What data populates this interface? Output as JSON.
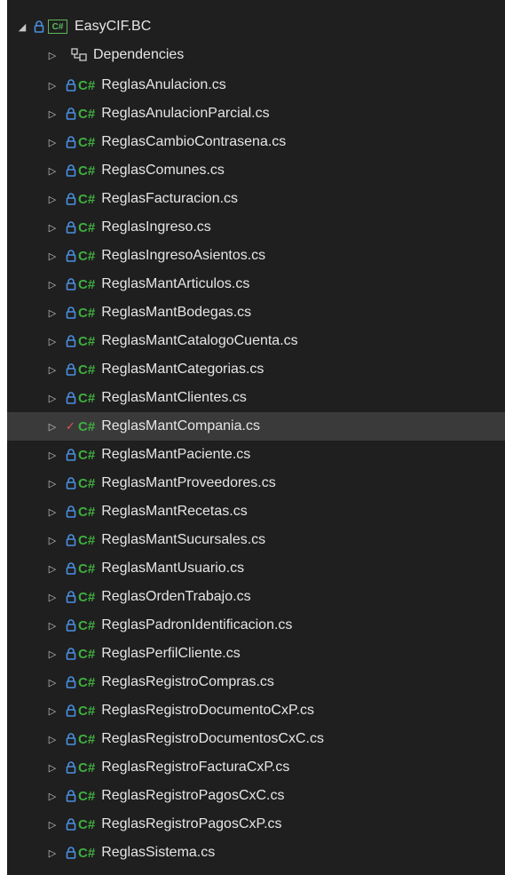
{
  "project": {
    "name": "EasyCIF.BC",
    "icon": "csharp-project-icon",
    "lock_icon": "lock-icon"
  },
  "dependencies": {
    "label": "Dependencies",
    "icon": "dependencies-icon"
  },
  "file_icon": "csharp-file-icon",
  "file_icon_text": "C#",
  "expand_glyph": "▷",
  "collapse_glyph": "◢",
  "files": [
    {
      "name": "ReglasAnulacion.cs",
      "status": "lock"
    },
    {
      "name": "ReglasAnulacionParcial.cs",
      "status": "lock"
    },
    {
      "name": "ReglasCambioContrasena.cs",
      "status": "lock"
    },
    {
      "name": "ReglasComunes.cs",
      "status": "lock"
    },
    {
      "name": "ReglasFacturacion.cs",
      "status": "lock"
    },
    {
      "name": "ReglasIngreso.cs",
      "status": "lock"
    },
    {
      "name": "ReglasIngresoAsientos.cs",
      "status": "lock"
    },
    {
      "name": "ReglasMantArticulos.cs",
      "status": "lock"
    },
    {
      "name": "ReglasMantBodegas.cs",
      "status": "lock"
    },
    {
      "name": "ReglasMantCatalogoCuenta.cs",
      "status": "lock"
    },
    {
      "name": "ReglasMantCategorias.cs",
      "status": "lock"
    },
    {
      "name": "ReglasMantClientes.cs",
      "status": "lock"
    },
    {
      "name": "ReglasMantCompania.cs",
      "status": "checked-out",
      "selected": true
    },
    {
      "name": "ReglasMantPaciente.cs",
      "status": "lock"
    },
    {
      "name": "ReglasMantProveedores.cs",
      "status": "lock"
    },
    {
      "name": "ReglasMantRecetas.cs",
      "status": "lock"
    },
    {
      "name": "ReglasMantSucursales.cs",
      "status": "lock"
    },
    {
      "name": "ReglasMantUsuario.cs",
      "status": "lock"
    },
    {
      "name": "ReglasOrdenTrabajo.cs",
      "status": "lock"
    },
    {
      "name": "ReglasPadronIdentificacion.cs",
      "status": "lock"
    },
    {
      "name": "ReglasPerfilCliente.cs",
      "status": "lock"
    },
    {
      "name": "ReglasRegistroCompras.cs",
      "status": "lock"
    },
    {
      "name": "ReglasRegistroDocumentoCxP.cs",
      "status": "lock"
    },
    {
      "name": "ReglasRegistroDocumentosCxC.cs",
      "status": "lock"
    },
    {
      "name": "ReglasRegistroFacturaCxP.cs",
      "status": "lock"
    },
    {
      "name": "ReglasRegistroPagosCxC.cs",
      "status": "lock"
    },
    {
      "name": "ReglasRegistroPagosCxP.cs",
      "status": "lock"
    },
    {
      "name": "ReglasSistema.cs",
      "status": "lock"
    }
  ],
  "colors": {
    "background": "#1f1f1f",
    "selected_row": "#3a3a3a",
    "lock": "#4a90e2",
    "csharp": "#3fae3f",
    "checkmark": "#e05252",
    "text": "#e6e6e6"
  }
}
